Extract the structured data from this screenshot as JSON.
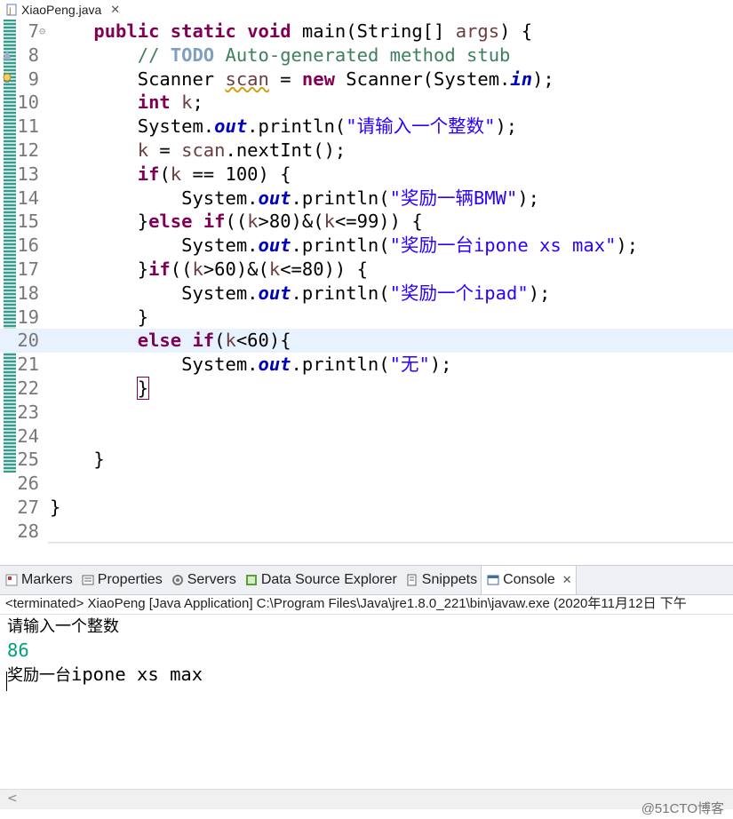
{
  "editor": {
    "file_tab": "XiaoPeng.java",
    "lines": [
      {
        "n": "7",
        "segs": [
          [
            "",
            "    "
          ],
          [
            "kw",
            "public"
          ],
          [
            "",
            " "
          ],
          [
            "kw",
            "static"
          ],
          [
            "",
            " "
          ],
          [
            "kw",
            "void"
          ],
          [
            "",
            " main(String[] "
          ],
          [
            "var",
            "args"
          ],
          [
            "",
            ") {"
          ]
        ]
      },
      {
        "n": "8",
        "segs": [
          [
            "",
            "        "
          ],
          [
            "cm",
            "// "
          ],
          [
            "todo",
            "TODO"
          ],
          [
            "cm",
            " Auto-generated method stub"
          ]
        ]
      },
      {
        "n": "9",
        "segs": [
          [
            "",
            "        Scanner "
          ],
          [
            "var warn-ul",
            "scan"
          ],
          [
            "",
            " = "
          ],
          [
            "kw",
            "new"
          ],
          [
            "",
            " Scanner(System."
          ],
          [
            "fld",
            "in"
          ],
          [
            "",
            ");"
          ]
        ]
      },
      {
        "n": "10",
        "segs": [
          [
            "",
            "        "
          ],
          [
            "kw",
            "int"
          ],
          [
            "",
            " "
          ],
          [
            "var",
            "k"
          ],
          [
            "",
            ";"
          ]
        ]
      },
      {
        "n": "11",
        "segs": [
          [
            "",
            "        System."
          ],
          [
            "fld",
            "out"
          ],
          [
            "",
            ".println("
          ],
          [
            "st",
            "\"请输入一个整数\""
          ],
          [
            "",
            ");"
          ]
        ]
      },
      {
        "n": "12",
        "segs": [
          [
            "",
            "        "
          ],
          [
            "var",
            "k"
          ],
          [
            "",
            " = "
          ],
          [
            "var",
            "scan"
          ],
          [
            "",
            ".nextInt();"
          ]
        ]
      },
      {
        "n": "13",
        "segs": [
          [
            "",
            "        "
          ],
          [
            "kw",
            "if"
          ],
          [
            "",
            "("
          ],
          [
            "var",
            "k"
          ],
          [
            "",
            " == 100) {"
          ]
        ]
      },
      {
        "n": "14",
        "segs": [
          [
            "",
            "            System."
          ],
          [
            "fld",
            "out"
          ],
          [
            "",
            ".println("
          ],
          [
            "st",
            "\"奖励一辆BMW\""
          ],
          [
            "",
            ");"
          ]
        ]
      },
      {
        "n": "15",
        "segs": [
          [
            "",
            "        }"
          ],
          [
            "kw",
            "else"
          ],
          [
            "",
            " "
          ],
          [
            "kw",
            "if"
          ],
          [
            "",
            "(("
          ],
          [
            "var",
            "k"
          ],
          [
            "",
            ">80)&("
          ],
          [
            "var",
            "k"
          ],
          [
            "",
            "<=99)) {"
          ]
        ]
      },
      {
        "n": "16",
        "segs": [
          [
            "",
            "            System."
          ],
          [
            "fld",
            "out"
          ],
          [
            "",
            ".println("
          ],
          [
            "st",
            "\"奖励一台ipone xs max\""
          ],
          [
            "",
            ");"
          ]
        ]
      },
      {
        "n": "17",
        "segs": [
          [
            "",
            "        }"
          ],
          [
            "kw",
            "if"
          ],
          [
            "",
            "(("
          ],
          [
            "var",
            "k"
          ],
          [
            "",
            ">60)&("
          ],
          [
            "var",
            "k"
          ],
          [
            "",
            "<=80)) {"
          ]
        ]
      },
      {
        "n": "18",
        "segs": [
          [
            "",
            "            System."
          ],
          [
            "fld",
            "out"
          ],
          [
            "",
            ".println("
          ],
          [
            "st",
            "\"奖励一个ipad\""
          ],
          [
            "",
            ");"
          ]
        ]
      },
      {
        "n": "19",
        "segs": [
          [
            "",
            "        }"
          ]
        ]
      },
      {
        "n": "20",
        "segs": [
          [
            "",
            "        "
          ],
          [
            "kw",
            "else"
          ],
          [
            "",
            " "
          ],
          [
            "kw",
            "if"
          ],
          [
            "",
            "("
          ],
          [
            "var",
            "k"
          ],
          [
            "",
            "<60){"
          ]
        ]
      },
      {
        "n": "21",
        "segs": [
          [
            "",
            "            System."
          ],
          [
            "fld",
            "out"
          ],
          [
            "",
            ".println("
          ],
          [
            "st",
            "\"无\""
          ],
          [
            "",
            ");"
          ]
        ]
      },
      {
        "n": "22",
        "segs": [
          [
            "",
            "        "
          ],
          [
            "bracket-box",
            "}"
          ]
        ]
      },
      {
        "n": "23",
        "segs": []
      },
      {
        "n": "24",
        "segs": []
      },
      {
        "n": "25",
        "segs": [
          [
            "",
            "    }"
          ]
        ]
      },
      {
        "n": "26",
        "segs": []
      },
      {
        "n": "27",
        "segs": [
          [
            "",
            "}"
          ]
        ]
      },
      {
        "n": "28",
        "segs": []
      }
    ]
  },
  "views": {
    "tabs": [
      {
        "label": "Markers",
        "icon": "markers-icon"
      },
      {
        "label": "Properties",
        "icon": "properties-icon"
      },
      {
        "label": "Servers",
        "icon": "servers-icon"
      },
      {
        "label": "Data Source Explorer",
        "icon": "data-source-icon"
      },
      {
        "label": "Snippets",
        "icon": "snippets-icon"
      },
      {
        "label": "Console",
        "icon": "console-icon",
        "active": true
      }
    ],
    "console_header": "<terminated> XiaoPeng [Java Application] C:\\Program Files\\Java\\jre1.8.0_221\\bin\\javaw.exe  (2020年11月12日 下午",
    "output": [
      "请输入一个整数",
      "86",
      "奖励一台ipone xs max"
    ]
  },
  "watermark": "@51CTO博客",
  "colors": {
    "keyword": "#7f0055",
    "comment": "#3f7f5f",
    "string": "#2a00ff",
    "field": "#0000c0",
    "input": "#00a080"
  }
}
